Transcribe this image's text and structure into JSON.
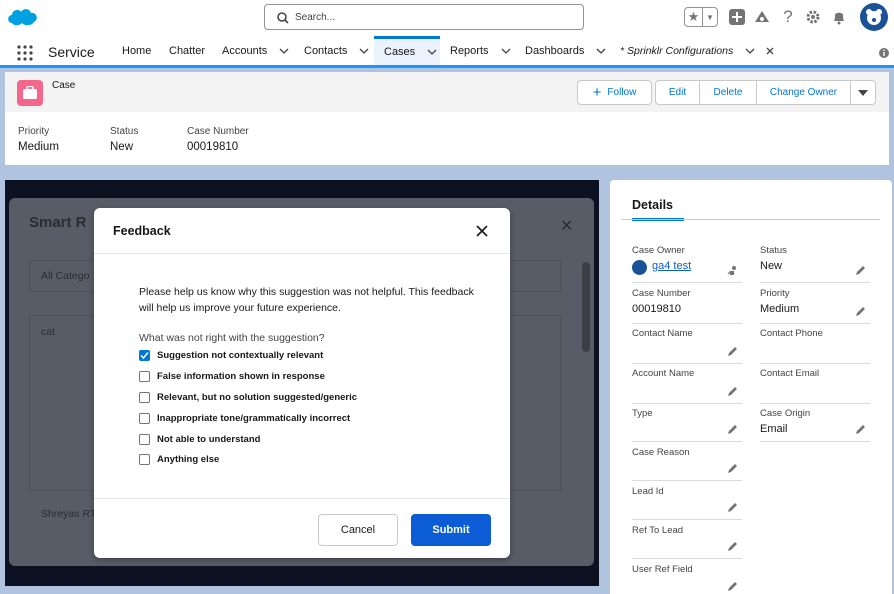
{
  "topbar": {
    "search_placeholder": "Search...",
    "icons": [
      "salesforce-logo",
      "search-icon",
      "star-icon",
      "chevron-down-icon",
      "add-icon",
      "trailhead-icon",
      "help-icon",
      "gear-icon",
      "bell-icon",
      "avatar"
    ]
  },
  "nav": {
    "app_name": "Service",
    "tabs": [
      {
        "label": "Home"
      },
      {
        "label": "Chatter"
      },
      {
        "label": "Accounts"
      },
      {
        "label": "Contacts"
      },
      {
        "label": "Cases"
      },
      {
        "label": "Reports"
      },
      {
        "label": "Dashboards"
      },
      {
        "label": "* Sprinklr Configurations"
      }
    ]
  },
  "record": {
    "object_label": "Case",
    "buttons": {
      "follow": "Follow",
      "edit": "Edit",
      "delete": "Delete",
      "change_owner": "Change Owner"
    },
    "highlights": [
      {
        "label": "Priority",
        "value": "Medium"
      },
      {
        "label": "Status",
        "value": "New"
      },
      {
        "label": "Case Number",
        "value": "00019810"
      }
    ]
  },
  "background_modal": {
    "title": "Smart R",
    "filter": "All Catego",
    "item": "cat",
    "footer_name": "Shreyas RT"
  },
  "feedback_modal": {
    "title": "Feedback",
    "message": "Please help us know why this suggestion was not helpful. This feedback will help us improve your future experience.",
    "question": "What was not right with the suggestion?",
    "options": [
      {
        "label": "Suggestion not contextually relevant",
        "checked": true
      },
      {
        "label": "False information shown in response",
        "checked": false
      },
      {
        "label": "Relevant, but no solution suggested/generic",
        "checked": false
      },
      {
        "label": "Inappropriate tone/grammatically incorrect",
        "checked": false
      },
      {
        "label": "Not able to understand",
        "checked": false
      },
      {
        "label": "Anything else",
        "checked": false
      }
    ],
    "cancel": "Cancel",
    "submit": "Submit"
  },
  "details": {
    "tab_label": "Details",
    "left": [
      {
        "label": "Case Owner",
        "value": "ga4 test"
      },
      {
        "label": "Case Number",
        "value": "00019810"
      },
      {
        "label": "Contact Name",
        "value": ""
      },
      {
        "label": "Account Name",
        "value": ""
      },
      {
        "label": "Type",
        "value": ""
      },
      {
        "label": "Case Reason",
        "value": ""
      },
      {
        "label": "Lead Id",
        "value": ""
      },
      {
        "label": "Ref To Lead",
        "value": ""
      },
      {
        "label": "User Ref Field",
        "value": ""
      }
    ],
    "right": [
      {
        "label": "Status",
        "value": "New"
      },
      {
        "label": "Priority",
        "value": "Medium"
      },
      {
        "label": "Contact Phone",
        "value": ""
      },
      {
        "label": "Contact Email",
        "value": ""
      },
      {
        "label": "Case Origin",
        "value": "Email"
      }
    ]
  },
  "colors": {
    "brand": "#0176d3",
    "submit": "#0b5cd5",
    "case_icon": "#f2678b",
    "logo": "#00a1e0"
  }
}
